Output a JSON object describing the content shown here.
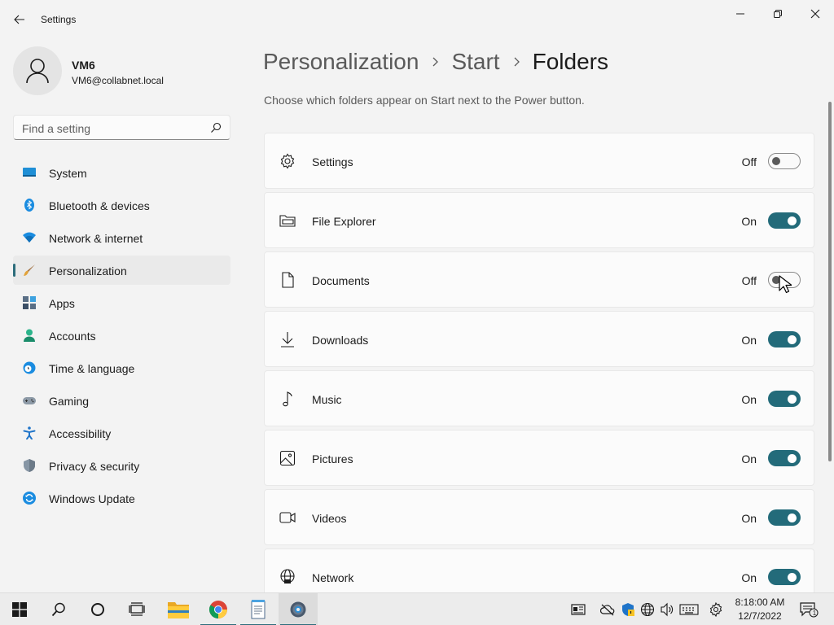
{
  "app": {
    "title": "Settings"
  },
  "user": {
    "name": "VM6",
    "email": "VM6@collabnet.local"
  },
  "search": {
    "placeholder": "Find a setting"
  },
  "sidebar": {
    "items": [
      {
        "label": "System",
        "icon": "system-icon"
      },
      {
        "label": "Bluetooth & devices",
        "icon": "bluetooth-icon"
      },
      {
        "label": "Network & internet",
        "icon": "wifi-icon"
      },
      {
        "label": "Personalization",
        "icon": "brush-icon",
        "active": true
      },
      {
        "label": "Apps",
        "icon": "apps-icon"
      },
      {
        "label": "Accounts",
        "icon": "accounts-icon"
      },
      {
        "label": "Time & language",
        "icon": "clock-globe-icon"
      },
      {
        "label": "Gaming",
        "icon": "gamepad-icon"
      },
      {
        "label": "Accessibility",
        "icon": "accessibility-icon"
      },
      {
        "label": "Privacy & security",
        "icon": "shield-icon"
      },
      {
        "label": "Windows Update",
        "icon": "update-icon"
      }
    ]
  },
  "breadcrumb": {
    "items": [
      "Personalization",
      "Start",
      "Folders"
    ]
  },
  "main": {
    "description": "Choose which folders appear on Start next to the Power button.",
    "folders": [
      {
        "label": "Settings",
        "state": "Off",
        "on": false,
        "icon": "gear-icon"
      },
      {
        "label": "File Explorer",
        "state": "On",
        "on": true,
        "icon": "folder-icon"
      },
      {
        "label": "Documents",
        "state": "Off",
        "on": false,
        "icon": "document-icon"
      },
      {
        "label": "Downloads",
        "state": "On",
        "on": true,
        "icon": "download-icon"
      },
      {
        "label": "Music",
        "state": "On",
        "on": true,
        "icon": "music-note-icon"
      },
      {
        "label": "Pictures",
        "state": "On",
        "on": true,
        "icon": "picture-icon"
      },
      {
        "label": "Videos",
        "state": "On",
        "on": true,
        "icon": "video-camera-icon"
      },
      {
        "label": "Network",
        "state": "On",
        "on": true,
        "icon": "globe-network-icon"
      }
    ]
  },
  "taskbar": {
    "clock": {
      "time": "8:18:00 AM",
      "date": "12/7/2022"
    },
    "notification_count": "1"
  },
  "colors": {
    "accent": "#236b7a",
    "background": "#f3f3f3",
    "card": "#fbfbfb"
  }
}
